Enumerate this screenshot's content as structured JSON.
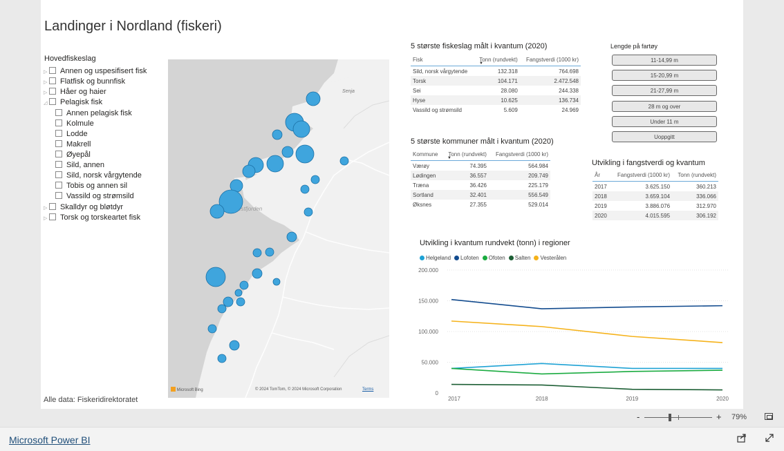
{
  "report": {
    "title": "Landinger i Nordland (fiskeri)",
    "source_note": "Alle data: Fiskeridirektoratet"
  },
  "slicer": {
    "title": "Hovedfiskeslag",
    "items": [
      {
        "label": "Annen og uspesifisert fisk",
        "level": 0,
        "arrow": "▷"
      },
      {
        "label": "Flatfisk og bunnfisk",
        "level": 0,
        "arrow": "▷"
      },
      {
        "label": "Håer og haier",
        "level": 0,
        "arrow": "▷"
      },
      {
        "label": "Pelagisk fisk",
        "level": 0,
        "arrow": "◿"
      },
      {
        "label": "Annen pelagisk fisk",
        "level": 1,
        "arrow": ""
      },
      {
        "label": "Kolmule",
        "level": 1,
        "arrow": ""
      },
      {
        "label": "Lodde",
        "level": 1,
        "arrow": ""
      },
      {
        "label": "Makrell",
        "level": 1,
        "arrow": ""
      },
      {
        "label": "Øyepål",
        "level": 1,
        "arrow": ""
      },
      {
        "label": "Sild, annen",
        "level": 1,
        "arrow": ""
      },
      {
        "label": "Sild, norsk vårgytende",
        "level": 1,
        "arrow": ""
      },
      {
        "label": "Tobis og annen sil",
        "level": 1,
        "arrow": ""
      },
      {
        "label": "Vassild og strømsild",
        "level": 1,
        "arrow": ""
      },
      {
        "label": "Skalldyr og bløtdyr",
        "level": 0,
        "arrow": "▷"
      },
      {
        "label": "Torsk og torskeartet fisk",
        "level": 0,
        "arrow": "▷"
      }
    ]
  },
  "map": {
    "labels": {
      "senja": "Senja",
      "vestfjorden": "Vestfjorden"
    },
    "provider": "Microsoft Bing",
    "copyright": "© 2024 TomTom, © 2024 Microsoft Corporation",
    "terms": "Terms",
    "bubble_color": "#3fa5dd"
  },
  "table_species": {
    "title": "5 største fiskeslag målt i kvantum (2020)",
    "headers": [
      "Fisk",
      "Tonn (rundvekt)",
      "Fangstverdi (1000 kr)"
    ],
    "rows": [
      [
        "Sild, norsk vårgytende",
        "132.318",
        "764.698"
      ],
      [
        "Torsk",
        "104.171",
        "2.472.548"
      ],
      [
        "Sei",
        "28.080",
        "244.338"
      ],
      [
        "Hyse",
        "10.625",
        "136.734"
      ],
      [
        "Vassild og strømsild",
        "5.609",
        "24.969"
      ]
    ]
  },
  "table_municipalities": {
    "title": "5 største kommuner målt i kvantum (2020)",
    "headers": [
      "Kommune",
      "Tonn (rundvekt)",
      "Fangstverdi (1000 kr)"
    ],
    "rows": [
      [
        "Værøy",
        "74.395",
        "564.984"
      ],
      [
        "Lødingen",
        "36.557",
        "209.749"
      ],
      [
        "Træna",
        "36.426",
        "225.179"
      ],
      [
        "Sortland",
        "32.401",
        "556.549"
      ],
      [
        "Øksnes",
        "27.355",
        "529.014"
      ]
    ]
  },
  "vessel_length": {
    "title": "Lengde på fartøy",
    "buttons": [
      "11-14,99 m",
      "15-20,99 m",
      "21-27,99 m",
      "28 m og over",
      "Under 11 m",
      "Uoppgitt"
    ]
  },
  "table_trend": {
    "title": "Utvikling i fangstverdi og kvantum",
    "headers": [
      "År",
      "Fangstverdi (1000 kr)",
      "Tonn (rundvekt)"
    ],
    "rows": [
      [
        "2017",
        "3.625.150",
        "360.213"
      ],
      [
        "2018",
        "3.659.104",
        "336.066"
      ],
      [
        "2019",
        "3.886.076",
        "312.970"
      ],
      [
        "2020",
        "4.015.595",
        "306.192"
      ]
    ]
  },
  "chart_data": {
    "type": "line",
    "title": "Utvikling i kvantum rundvekt (tonn) i regioner",
    "x": [
      "2017",
      "2018",
      "2019",
      "2020"
    ],
    "ylim": [
      0,
      200000
    ],
    "yticks": [
      "0",
      "50.000",
      "100.000",
      "150.000",
      "200.000"
    ],
    "legend_position": "top-left",
    "series": [
      {
        "name": "Helgeland",
        "color": "#1ea2d4",
        "values": [
          40000,
          48000,
          40000,
          40000
        ]
      },
      {
        "name": "Lofoten",
        "color": "#124b8e",
        "values": [
          152000,
          137000,
          140000,
          142000
        ]
      },
      {
        "name": "Ofoten",
        "color": "#1aab40",
        "values": [
          40000,
          31000,
          35000,
          37000
        ]
      },
      {
        "name": "Salten",
        "color": "#1c5e34",
        "values": [
          14000,
          13000,
          6000,
          5000
        ]
      },
      {
        "name": "Vesterålen",
        "color": "#f5b21a",
        "values": [
          117000,
          108000,
          92000,
          82000
        ]
      }
    ]
  },
  "statusbar": {
    "zoom_minus": "-",
    "zoom_plus": "+",
    "zoom_level": "79%"
  },
  "brand": {
    "link": "Microsoft Power BI"
  }
}
